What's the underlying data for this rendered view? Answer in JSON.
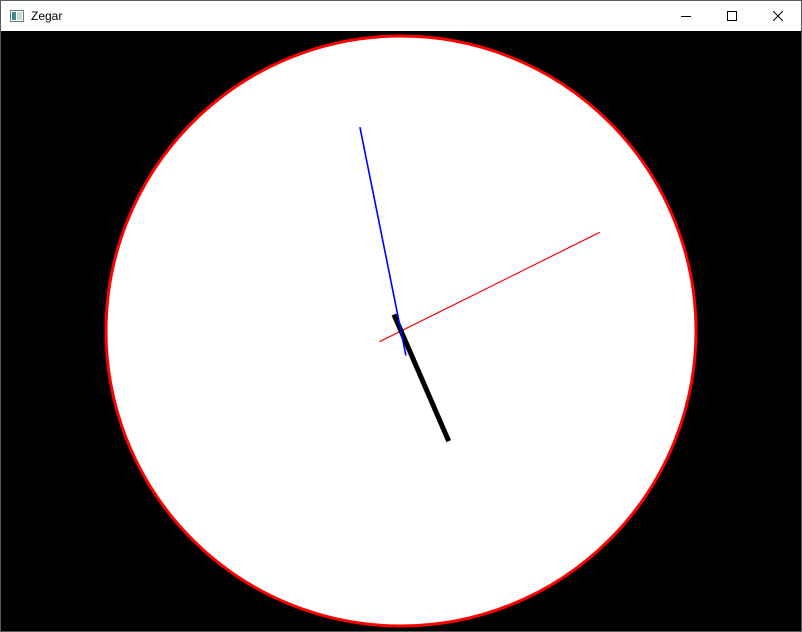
{
  "window": {
    "title": "Zegar",
    "app_icon": "window-app-icon",
    "buttons": [
      {
        "name": "minimize",
        "icon": "minimize-icon"
      },
      {
        "name": "maximize",
        "icon": "maximize-icon"
      },
      {
        "name": "close",
        "icon": "close-icon"
      }
    ]
  },
  "clock": {
    "background_color": "#000000",
    "face_color": "#ffffff",
    "rim_color": "#ff0000",
    "hands": {
      "hour": {
        "color": "#000000",
        "position_minutes_of_hour_dial": 26.1
      },
      "minute": {
        "color": "#0000ff",
        "position_minutes": 58.1
      },
      "second": {
        "color": "#ff0000",
        "position_seconds": 10.6
      }
    }
  }
}
